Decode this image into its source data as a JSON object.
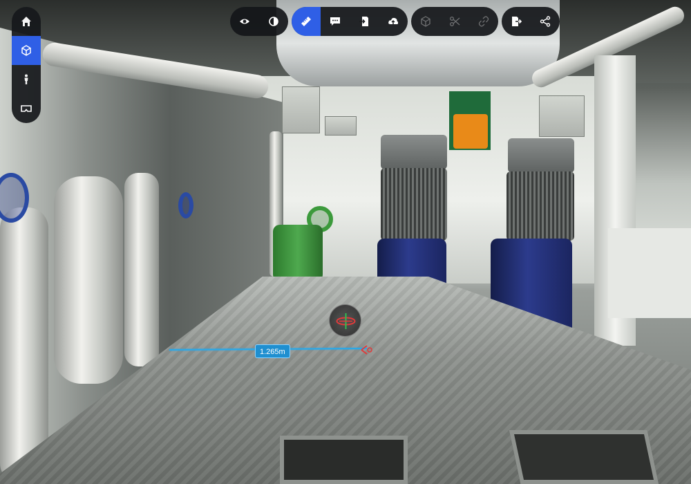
{
  "app": {
    "accent_color": "#2f5fe6",
    "measure_color": "#2aa8e8"
  },
  "side_nav": {
    "items": [
      {
        "icon": "home-icon",
        "active": false
      },
      {
        "icon": "floorplan-dollhouse-icon",
        "active": true
      },
      {
        "icon": "person-walk-icon",
        "active": false
      },
      {
        "icon": "vr-headset-icon",
        "active": false
      }
    ]
  },
  "toolbar": {
    "groups": [
      [
        {
          "icon": "eye-icon",
          "active": false,
          "disabled": false
        },
        {
          "icon": "contrast-icon",
          "active": false,
          "disabled": false
        }
      ],
      [
        {
          "icon": "ruler-measure-icon",
          "active": true,
          "disabled": false
        },
        {
          "icon": "comment-icon",
          "active": false,
          "disabled": false
        },
        {
          "icon": "import-document-icon",
          "active": false,
          "disabled": false
        },
        {
          "icon": "upload-cloud-icon",
          "active": false,
          "disabled": false
        }
      ],
      [
        {
          "icon": "cube-icon",
          "active": false,
          "disabled": true
        },
        {
          "icon": "scissors-icon",
          "active": false,
          "disabled": true
        },
        {
          "icon": "link-icon",
          "active": false,
          "disabled": true
        }
      ],
      [
        {
          "icon": "export-icon",
          "active": false,
          "disabled": false
        },
        {
          "icon": "share-icon",
          "active": false,
          "disabled": false
        }
      ]
    ]
  },
  "measurement": {
    "label": "1.265m"
  }
}
